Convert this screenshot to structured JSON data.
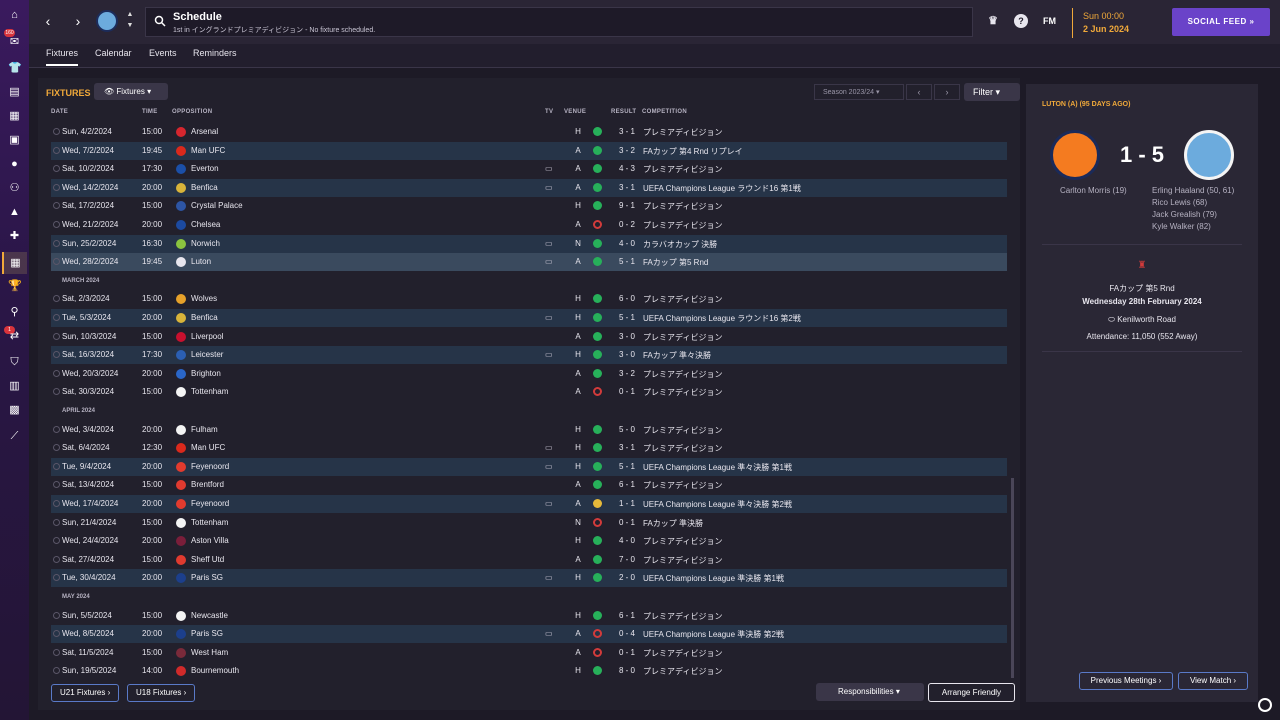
{
  "header": {
    "title": "Schedule",
    "subtitle": "1st in イングランドプレミアディビジョン - No fixture scheduled.",
    "fm": "FM",
    "time": "Sun 00:00",
    "date": "2 Jun 2024",
    "social": "SOCIAL FEED"
  },
  "rail": {
    "badge1": "160",
    "badge2": "1"
  },
  "tabs": [
    "Fixtures",
    "Calendar",
    "Events",
    "Reminders"
  ],
  "main": {
    "label": "FIXTURES",
    "dropdown": "Fixtures",
    "season": "Season 2023/24",
    "filter": "Filter",
    "columns": [
      "DATE",
      "TIME",
      "OPPOSITION",
      "TV",
      "VENUE",
      "RESULT",
      "COMPETITION"
    ],
    "months": [
      "MARCH 2024",
      "APRIL 2024",
      "MAY 2024"
    ],
    "footer": {
      "u21": "U21 Fixtures",
      "u18": "U18 Fixtures",
      "resp": "Responsibilities",
      "arrange": "Arrange Friendly"
    }
  },
  "fixtures": [
    {
      "date": "Sun, 4/2/2024",
      "time": "15:00",
      "opp": "Arsenal",
      "tv": "",
      "venue": "H",
      "res": "w",
      "score": "3 - 1",
      "comp": "プレミアディビジョン",
      "crest": "#d6262e"
    },
    {
      "date": "Wed, 7/2/2024",
      "time": "19:45",
      "opp": "Man UFC",
      "tv": "",
      "venue": "A",
      "res": "w",
      "score": "3 - 2",
      "comp": "FAカップ 第4 Rnd リプレイ",
      "crest": "#da291c"
    },
    {
      "date": "Sat, 10/2/2024",
      "time": "17:30",
      "opp": "Everton",
      "tv": "▭",
      "venue": "A",
      "res": "w",
      "score": "4 - 3",
      "comp": "プレミアディビジョン",
      "crest": "#1b4fa8"
    },
    {
      "date": "Wed, 14/2/2024",
      "time": "20:00",
      "opp": "Benfica",
      "tv": "▭",
      "venue": "A",
      "res": "w",
      "score": "3 - 1",
      "comp": "UEFA Champions League ラウンド16 第1戦",
      "crest": "#d8b43a"
    },
    {
      "date": "Sat, 17/2/2024",
      "time": "15:00",
      "opp": "Crystal Palace",
      "tv": "",
      "venue": "H",
      "res": "w",
      "score": "9 - 1",
      "comp": "プレミアディビジョン",
      "crest": "#2d55a4"
    },
    {
      "date": "Wed, 21/2/2024",
      "time": "20:00",
      "opp": "Chelsea",
      "tv": "",
      "venue": "A",
      "res": "l",
      "score": "0 - 2",
      "comp": "プレミアディビジョン",
      "crest": "#1c4aa0"
    },
    {
      "date": "Sun, 25/2/2024",
      "time": "16:30",
      "opp": "Norwich",
      "tv": "▭",
      "venue": "N",
      "res": "w",
      "score": "4 - 0",
      "comp": "カラバオカップ 決勝",
      "crest": "#8bc43f"
    },
    {
      "date": "Wed, 28/2/2024",
      "time": "19:45",
      "opp": "Luton",
      "tv": "▭",
      "venue": "A",
      "res": "w",
      "score": "5 - 1",
      "comp": "FAカップ 第5 Rnd",
      "crest": "#e8e6ee"
    },
    {
      "date": "Sat, 2/3/2024",
      "time": "15:00",
      "opp": "Wolves",
      "tv": "",
      "venue": "H",
      "res": "w",
      "score": "6 - 0",
      "comp": "プレミアディビジョン",
      "crest": "#e6a12a"
    },
    {
      "date": "Tue, 5/3/2024",
      "time": "20:00",
      "opp": "Benfica",
      "tv": "▭",
      "venue": "H",
      "res": "w",
      "score": "5 - 1",
      "comp": "UEFA Champions League ラウンド16 第2戦",
      "crest": "#d8b43a"
    },
    {
      "date": "Sun, 10/3/2024",
      "time": "15:00",
      "opp": "Liverpool",
      "tv": "",
      "venue": "A",
      "res": "w",
      "score": "3 - 0",
      "comp": "プレミアディビジョン",
      "crest": "#c8102e"
    },
    {
      "date": "Sat, 16/3/2024",
      "time": "17:30",
      "opp": "Leicester",
      "tv": "▭",
      "venue": "H",
      "res": "w",
      "score": "3 - 0",
      "comp": "FAカップ 準々決勝",
      "crest": "#2b5fb3"
    },
    {
      "date": "Wed, 20/3/2024",
      "time": "20:00",
      "opp": "Brighton",
      "tv": "",
      "venue": "A",
      "res": "w",
      "score": "3 - 2",
      "comp": "プレミアディビジョン",
      "crest": "#2a66c8"
    },
    {
      "date": "Sat, 30/3/2024",
      "time": "15:00",
      "opp": "Tottenham",
      "tv": "",
      "venue": "A",
      "res": "l",
      "score": "0 - 1",
      "comp": "プレミアディビジョン",
      "crest": "#f4f4f4"
    },
    {
      "date": "Wed, 3/4/2024",
      "time": "20:00",
      "opp": "Fulham",
      "tv": "",
      "venue": "H",
      "res": "w",
      "score": "5 - 0",
      "comp": "プレミアディビジョン",
      "crest": "#f4f4f4"
    },
    {
      "date": "Sat, 6/4/2024",
      "time": "12:30",
      "opp": "Man UFC",
      "tv": "▭",
      "venue": "H",
      "res": "w",
      "score": "3 - 1",
      "comp": "プレミアディビジョン",
      "crest": "#da291c"
    },
    {
      "date": "Tue, 9/4/2024",
      "time": "20:00",
      "opp": "Feyenoord",
      "tv": "▭",
      "venue": "H",
      "res": "w",
      "score": "5 - 1",
      "comp": "UEFA Champions League 準々決勝 第1戦",
      "crest": "#e23b2e"
    },
    {
      "date": "Sat, 13/4/2024",
      "time": "15:00",
      "opp": "Brentford",
      "tv": "",
      "venue": "A",
      "res": "w",
      "score": "6 - 1",
      "comp": "プレミアディビジョン",
      "crest": "#e03a2f"
    },
    {
      "date": "Wed, 17/4/2024",
      "time": "20:00",
      "opp": "Feyenoord",
      "tv": "▭",
      "venue": "A",
      "res": "d",
      "score": "1 - 1",
      "comp": "UEFA Champions League 準々決勝 第2戦",
      "crest": "#e23b2e"
    },
    {
      "date": "Sun, 21/4/2024",
      "time": "15:00",
      "opp": "Tottenham",
      "tv": "",
      "venue": "N",
      "res": "l",
      "score": "0 - 1",
      "comp": "FAカップ 準決勝",
      "crest": "#f4f4f4"
    },
    {
      "date": "Wed, 24/4/2024",
      "time": "20:00",
      "opp": "Aston Villa",
      "tv": "",
      "venue": "H",
      "res": "w",
      "score": "4 - 0",
      "comp": "プレミアディビジョン",
      "crest": "#7a1e3a"
    },
    {
      "date": "Sat, 27/4/2024",
      "time": "15:00",
      "opp": "Sheff Utd",
      "tv": "",
      "venue": "A",
      "res": "w",
      "score": "7 - 0",
      "comp": "プレミアディビジョン",
      "crest": "#e03a2f"
    },
    {
      "date": "Tue, 30/4/2024",
      "time": "20:00",
      "opp": "Paris SG",
      "tv": "▭",
      "venue": "H",
      "res": "w",
      "score": "2 - 0",
      "comp": "UEFA Champions League 準決勝 第1戦",
      "crest": "#1c3f8c"
    },
    {
      "date": "Sun, 5/5/2024",
      "time": "15:00",
      "opp": "Newcastle",
      "tv": "",
      "venue": "H",
      "res": "w",
      "score": "6 - 1",
      "comp": "プレミアディビジョン",
      "crest": "#f4f4f4"
    },
    {
      "date": "Wed, 8/5/2024",
      "time": "20:00",
      "opp": "Paris SG",
      "tv": "▭",
      "venue": "A",
      "res": "l",
      "score": "0 - 4",
      "comp": "UEFA Champions League 準決勝 第2戦",
      "crest": "#1c3f8c"
    },
    {
      "date": "Sat, 11/5/2024",
      "time": "15:00",
      "opp": "West Ham",
      "tv": "",
      "venue": "A",
      "res": "l",
      "score": "0 - 1",
      "comp": "プレミアディビジョン",
      "crest": "#7a2a3a"
    },
    {
      "date": "Sun, 19/5/2024",
      "time": "14:00",
      "opp": "Bournemouth",
      "tv": "",
      "venue": "H",
      "res": "w",
      "score": "8 - 0",
      "comp": "プレミアディビジョン",
      "crest": "#d02a2a"
    }
  ],
  "side": {
    "title": "LUTON (A) (95 DAYS AGO)",
    "score": "1 - 5",
    "home_scorers": [
      "Carlton Morris (19)"
    ],
    "away_scorers": [
      "Erling Haaland (50, 61)",
      "Rico Lewis (68)",
      "Jack Grealish (79)",
      "Kyle Walker (82)"
    ],
    "competition": "FAカップ 第5 Rnd",
    "date": "Wednesday 28th February 2024",
    "venue": "Kenilworth Road",
    "attendance": "Attendance: 11,050 (552 Away)",
    "prev": "Previous Meetings",
    "view": "View Match"
  }
}
